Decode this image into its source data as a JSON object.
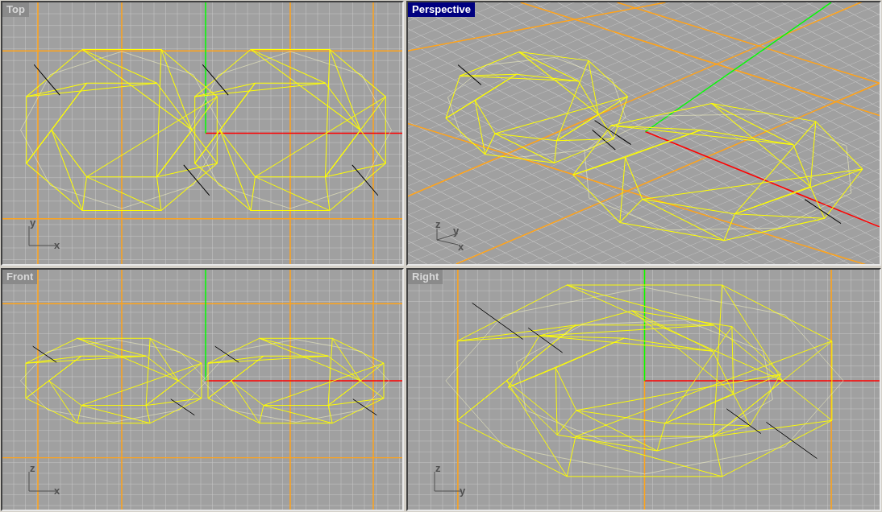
{
  "viewports": [
    {
      "kind": "top",
      "title": "Top",
      "selected": false,
      "axis_labels": [
        "y",
        "x"
      ]
    },
    {
      "kind": "perspective",
      "title": "Perspective",
      "selected": true,
      "axis_labels": [
        "z",
        "y",
        "x"
      ]
    },
    {
      "kind": "front",
      "title": "Front",
      "selected": false,
      "axis_labels": [
        "z",
        "x"
      ]
    },
    {
      "kind": "right",
      "title": "Right",
      "selected": false,
      "axis_labels": [
        "z",
        "y"
      ]
    }
  ]
}
